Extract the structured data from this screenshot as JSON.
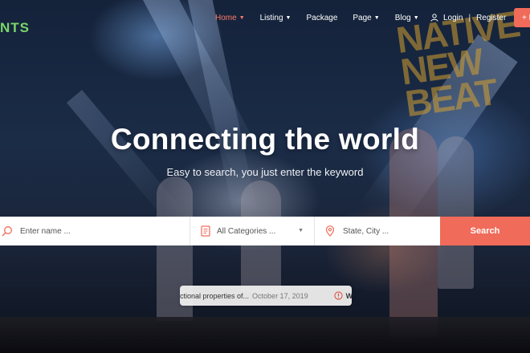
{
  "brand": {
    "logo_text": "NTS"
  },
  "nav": {
    "items": [
      {
        "label": "Home",
        "active": true,
        "dropdown": true
      },
      {
        "label": "Listing",
        "active": false,
        "dropdown": true
      },
      {
        "label": "Package",
        "active": false,
        "dropdown": false
      },
      {
        "label": "Page",
        "active": false,
        "dropdown": true
      },
      {
        "label": "Blog",
        "active": false,
        "dropdown": true
      }
    ],
    "login_label": "Login",
    "separator": "|",
    "register_label": "Register",
    "add_button_label": "+ L"
  },
  "hero": {
    "title": "Connecting the world",
    "subtitle": "Easy to search, you just enter the keyword",
    "background_sign_text": "NATIVE NEW BEAT"
  },
  "search": {
    "name_placeholder": "Enter name ...",
    "category_selected": "All Categories ...",
    "location_placeholder": "State, City ...",
    "button_label": "Search"
  },
  "notification": {
    "title": "ctional properties of...",
    "date": "October 17, 2019",
    "next_label": "W"
  },
  "colors": {
    "accent": "#f06b5a",
    "nav_active": "#ff7a6b",
    "logo": "#7bd66a"
  },
  "icons": {
    "search_field": "search-icon",
    "category_field": "list-document-icon",
    "location_field": "map-pin-icon",
    "notification": "info-circle-icon",
    "auth": "user-icon"
  }
}
